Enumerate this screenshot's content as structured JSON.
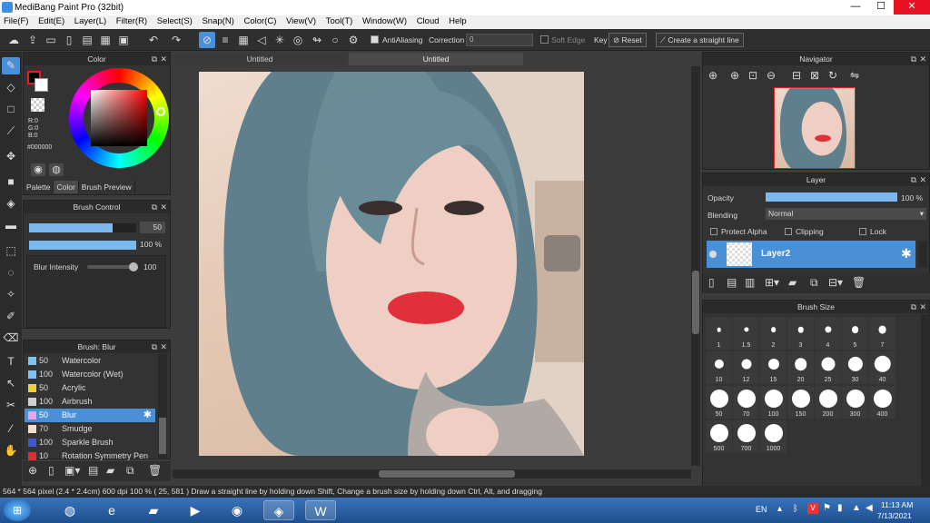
{
  "window": {
    "title": "MediBang Paint Pro (32bit)",
    "minimize": "—",
    "maximize": "☐",
    "close": "✕"
  },
  "menu": [
    "File(F)",
    "Edit(E)",
    "Layer(L)",
    "Filter(R)",
    "Select(S)",
    "Snap(N)",
    "Color(C)",
    "View(V)",
    "Tool(T)",
    "Window(W)",
    "Cloud",
    "Help"
  ],
  "toolbar": {
    "antialiasing_label": "AntiAliasing",
    "correction_label": "Correction",
    "correction_value": "0",
    "soft_edge_label": "Soft Edge",
    "key_label": "Key",
    "reset_label": "Reset",
    "straight_line_label": "Create a straight line"
  },
  "color_panel": {
    "title": "Color",
    "r": "R:0",
    "g": "G:0",
    "b": "B:0",
    "hex": "#000000",
    "tabs": [
      "Palette",
      "Color",
      "Brush Preview"
    ],
    "selected_tab": "Color"
  },
  "brush_control": {
    "title": "Brush Control",
    "size_value": "50",
    "size_fraction": 0.78,
    "opacity_value": "100 %",
    "opacity_fraction": 1.0,
    "blur_label": "Blur Intensity",
    "blur_value": "100",
    "blur_fraction": 1.0
  },
  "brush_list": {
    "title": "Brush: Blur",
    "items": [
      {
        "size": "50",
        "name": "Watercolor",
        "color": "#7fc3f0"
      },
      {
        "size": "100",
        "name": "Watercolor (Wet)",
        "color": "#7fc3f0"
      },
      {
        "size": "50",
        "name": "Acrylic",
        "color": "#e8d23a"
      },
      {
        "size": "100",
        "name": "Airbrush",
        "color": "#cfcfcf"
      },
      {
        "size": "50",
        "name": "Blur",
        "color": "#e7a6e0",
        "selected": true
      },
      {
        "size": "70",
        "name": "Smudge",
        "color": "#f1dcc4"
      },
      {
        "size": "100",
        "name": "Sparkle Brush",
        "color": "#3f56d9"
      },
      {
        "size": "10",
        "name": "Rotation Symmetry Pen",
        "color": "#e02f2f"
      }
    ]
  },
  "documents": {
    "tabs": [
      "Untitled",
      "Untitled"
    ],
    "active_tab": 1
  },
  "navigator": {
    "title": "Navigator"
  },
  "layer_panel": {
    "title": "Layer",
    "opacity_label": "Opacity",
    "opacity_value": "100 %",
    "opacity_fraction": 1.0,
    "blending_label": "Blending",
    "blending_value": "Normal",
    "protect_alpha_label": "Protect Alpha",
    "clipping_label": "Clipping",
    "lock_label": "Lock",
    "layer_name": "Layer2"
  },
  "brush_size_panel": {
    "title": "Brush Size",
    "sizes": [
      "1",
      "1.5",
      "2",
      "3",
      "4",
      "5",
      "7",
      "10",
      "12",
      "15",
      "20",
      "25",
      "30",
      "40",
      "50",
      "70",
      "100",
      "150",
      "200",
      "300",
      "400",
      "500",
      "700",
      "1000"
    ]
  },
  "status": {
    "text": "564 * 564 pixel   (2.4 * 2.4cm)   600 dpi   100 %   ( 25, 581 )   Draw a straight line by holding down Shift, Change a brush size by holding down Ctrl, Alt, and dragging"
  },
  "taskbar": {
    "language": "EN",
    "time": "11:13 AM",
    "date": "7/13/2021"
  },
  "colors": {
    "accent": "#4a90d9",
    "panel_bg": "#333333",
    "lip_red": "#e0303a"
  }
}
